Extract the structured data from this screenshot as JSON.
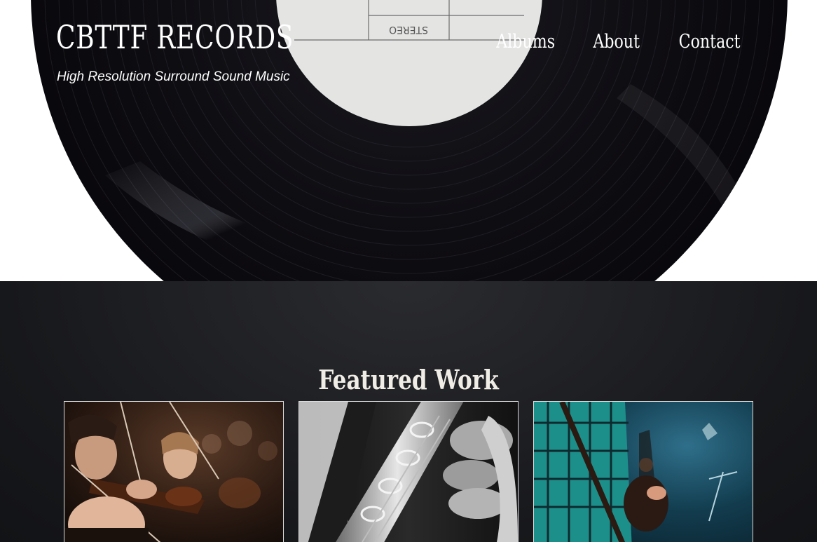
{
  "header": {
    "brand": "CBTTF RECORDS",
    "tagline": "High Resolution Surround Sound Music",
    "nav": [
      {
        "label": "Albums"
      },
      {
        "label": "About"
      },
      {
        "label": "Contact"
      }
    ],
    "record_label_text": "STEREO"
  },
  "featured": {
    "title": "Featured Work",
    "cards": [
      {
        "image": "orchestra-violinists-photo"
      },
      {
        "image": "saxophone-closeup-photo"
      },
      {
        "image": "guitarist-on-stage-photo"
      }
    ]
  },
  "colors": {
    "hero_bg": "#ffffff",
    "vinyl": "#0e0d12",
    "label": "#e4e5e3",
    "featured_bg": "#1a1b1e",
    "text": "#ffffff"
  }
}
